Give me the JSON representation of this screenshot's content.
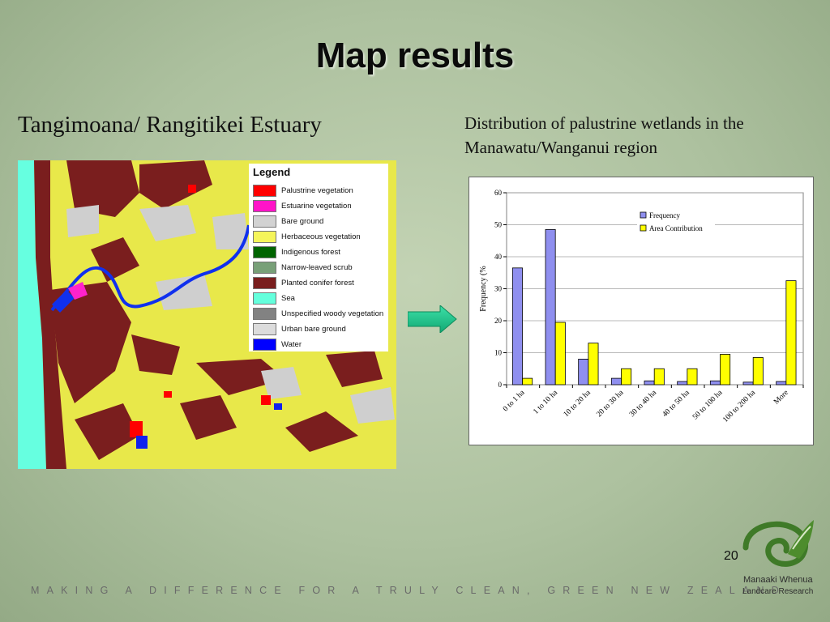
{
  "slide": {
    "title": "Map results",
    "left_heading": "Tangimoana/ Rangitikei Estuary",
    "right_heading": "Distribution of palustrine wetlands in the Manawatu/Wanganui region",
    "page_number": "20",
    "footer": "MAKING A DIFFERENCE FOR A TRULY CLEAN, GREEN NEW ZEALAND",
    "logo_name": "Manaaki Whenua",
    "logo_sub": "Landcare Research"
  },
  "map": {
    "legend_title": "Legend",
    "legend_items": [
      {
        "label": "Palustrine vegetation",
        "color": "#ff0000"
      },
      {
        "label": "Estuarine vegetation",
        "color": "#ff14c8"
      },
      {
        "label": "Bare ground",
        "color": "#d2d2d2"
      },
      {
        "label": "Herbaceous vegetation",
        "color": "#f5f55a"
      },
      {
        "label": "Indigenous forest",
        "color": "#006400"
      },
      {
        "label": "Narrow-leaved scrub",
        "color": "#78a078"
      },
      {
        "label": "Planted conifer forest",
        "color": "#7a1e1e"
      },
      {
        "label": "Sea",
        "color": "#64ffdc"
      },
      {
        "label": "Unspecified woody vegetation",
        "color": "#828282"
      },
      {
        "label": "Urban bare ground",
        "color": "#dcdcdc"
      },
      {
        "label": "Water",
        "color": "#0000ff"
      }
    ]
  },
  "chart_data": {
    "type": "bar",
    "categories": [
      "0 to 1 ha",
      "1 to 10 ha",
      "10 to 20 ha",
      "20 to 30 ha",
      "30 to 40 ha",
      "40 to 50 ha",
      "50 to 100 ha",
      "100 to 200 ha",
      "More"
    ],
    "series": [
      {
        "name": "Frequency",
        "color": "#8f8fef",
        "values": [
          36.5,
          48.5,
          8,
          2,
          1.2,
          1,
          1.2,
          0.8,
          1
        ]
      },
      {
        "name": "Area Contribution",
        "color": "#ffff00",
        "values": [
          2,
          19.5,
          13,
          5,
          5,
          5,
          9.5,
          8.5,
          32.5
        ]
      }
    ],
    "ylabel": "Frequency (%",
    "xlabel": "",
    "ylim": [
      0,
      60
    ],
    "yticks": [
      0,
      10,
      20,
      30,
      40,
      50,
      60
    ],
    "grid": true,
    "legend": "top-right"
  }
}
